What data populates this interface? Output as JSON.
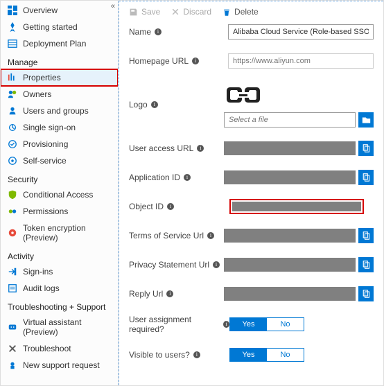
{
  "toolbar": {
    "save": "Save",
    "discard": "Discard",
    "delete": "Delete"
  },
  "sidebar": {
    "top": [
      {
        "label": "Overview"
      },
      {
        "label": "Getting started"
      },
      {
        "label": "Deployment Plan"
      }
    ],
    "sections": {
      "manage": {
        "title": "Manage",
        "items": [
          {
            "label": "Properties"
          },
          {
            "label": "Owners"
          },
          {
            "label": "Users and groups"
          },
          {
            "label": "Single sign-on"
          },
          {
            "label": "Provisioning"
          },
          {
            "label": "Self-service"
          }
        ]
      },
      "security": {
        "title": "Security",
        "items": [
          {
            "label": "Conditional Access"
          },
          {
            "label": "Permissions"
          },
          {
            "label": "Token encryption (Preview)"
          }
        ]
      },
      "activity": {
        "title": "Activity",
        "items": [
          {
            "label": "Sign-ins"
          },
          {
            "label": "Audit logs"
          }
        ]
      },
      "support": {
        "title": "Troubleshooting + Support",
        "items": [
          {
            "label": "Virtual assistant (Preview)"
          },
          {
            "label": "Troubleshoot"
          },
          {
            "label": "New support request"
          }
        ]
      }
    }
  },
  "form": {
    "name": {
      "label": "Name",
      "value": "Alibaba Cloud Service (Role-based SSO)"
    },
    "homepage": {
      "label": "Homepage URL",
      "placeholder": "https://www.aliyun.com"
    },
    "logo": {
      "label": "Logo",
      "file_placeholder": "Select a file"
    },
    "user_access": {
      "label": "User access URL"
    },
    "app_id": {
      "label": "Application ID"
    },
    "object_id": {
      "label": "Object ID"
    },
    "tos": {
      "label": "Terms of Service Url"
    },
    "privacy": {
      "label": "Privacy Statement Url"
    },
    "reply": {
      "label": "Reply Url"
    },
    "assignment": {
      "label": "User assignment required?",
      "yes": "Yes",
      "no": "No"
    },
    "visible": {
      "label": "Visible to users?",
      "yes": "Yes",
      "no": "No"
    }
  }
}
